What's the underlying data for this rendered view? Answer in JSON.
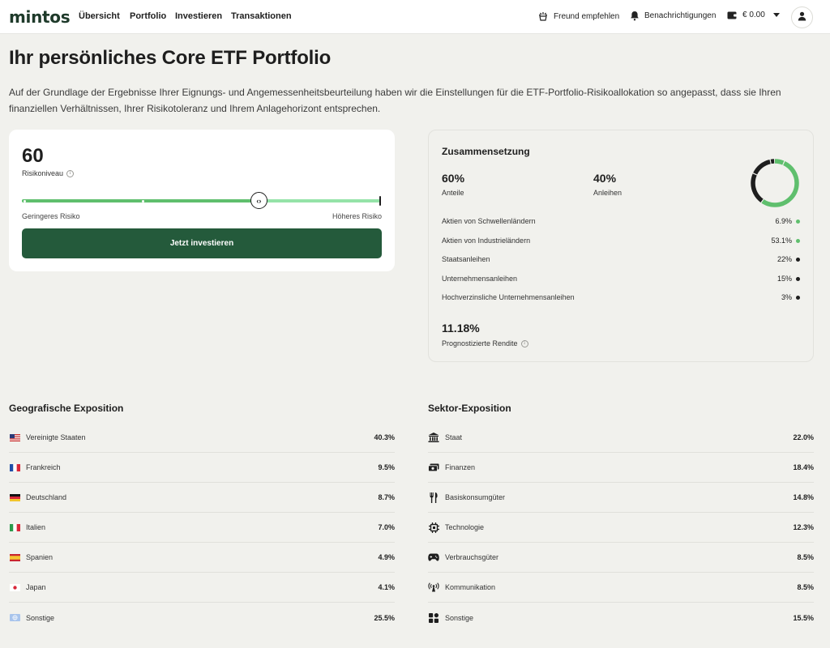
{
  "nav": {
    "logo": "mintos",
    "links": [
      "Übersicht",
      "Portfolio",
      "Investieren",
      "Transaktionen"
    ],
    "refer": "Freund empfehlen",
    "notifications": "Benachrichtigungen",
    "balance": "€ 0.00"
  },
  "page": {
    "title": "Ihr persönliches Core ETF Portfolio",
    "intro": "Auf der Grundlage der Ergebnisse Ihrer Eignungs- und Angemessenheitsbeurteilung haben wir die Einstellungen für die ETF-Portfolio-Risikoallokation so angepasst, dass sie Ihren finanziellen Verhältnissen, Ihrer Risikotoleranz und Ihrem Anlagehorizont entsprechen."
  },
  "risk": {
    "value": "60",
    "label": "Risikoniveau",
    "level_fraction": 0.66,
    "knob_glyph": "‹›",
    "min_label": "Geringeres Risiko",
    "max_label": "Höheres Risiko",
    "button": "Jetzt investieren"
  },
  "composition": {
    "title": "Zusammensetzung",
    "shares_value": "60%",
    "shares_label": "Anteile",
    "bonds_value": "40%",
    "bonds_label": "Anleihen",
    "rows": [
      {
        "label": "Aktien von Schwellenländern",
        "value": "6.9%",
        "color": "#5fbf6d",
        "pct": 6.9
      },
      {
        "label": "Aktien von Industrieländern",
        "value": "53.1%",
        "color": "#5fbf6d",
        "pct": 53.1
      },
      {
        "label": "Staatsanleihen",
        "value": "22%",
        "color": "#1e1e1e",
        "pct": 22
      },
      {
        "label": "Unternehmensanleihen",
        "value": "15%",
        "color": "#1e1e1e",
        "pct": 15
      },
      {
        "label": "Hochverzinsliche Unternehmensanleihen",
        "value": "3%",
        "color": "#1e1e1e",
        "pct": 3
      }
    ],
    "return_value": "11.18%",
    "return_label": "Prognostizierte Rendite"
  },
  "geo": {
    "title": "Geografische Exposition",
    "rows": [
      {
        "label": "Vereinigte Staaten",
        "value": "40.3%",
        "icon": "flag-us"
      },
      {
        "label": "Frankreich",
        "value": "9.5%",
        "icon": "flag-fr"
      },
      {
        "label": "Deutschland",
        "value": "8.7%",
        "icon": "flag-de"
      },
      {
        "label": "Italien",
        "value": "7.0%",
        "icon": "flag-it"
      },
      {
        "label": "Spanien",
        "value": "4.9%",
        "icon": "flag-es"
      },
      {
        "label": "Japan",
        "value": "4.1%",
        "icon": "flag-jp"
      },
      {
        "label": "Sonstige",
        "value": "25.5%",
        "icon": "globe-flag"
      }
    ]
  },
  "sector": {
    "title": "Sektor-Exposition",
    "rows": [
      {
        "label": "Staat",
        "value": "22.0%",
        "icon": "government-building-icon"
      },
      {
        "label": "Finanzen",
        "value": "18.4%",
        "icon": "money-icon"
      },
      {
        "label": "Basiskonsumgüter",
        "value": "14.8%",
        "icon": "cutlery-icon"
      },
      {
        "label": "Technologie",
        "value": "12.3%",
        "icon": "chip-icon"
      },
      {
        "label": "Verbrauchsgüter",
        "value": "8.5%",
        "icon": "gamepad-icon"
      },
      {
        "label": "Kommunikation",
        "value": "8.5%",
        "icon": "antenna-icon"
      },
      {
        "label": "Sonstige",
        "value": "15.5%",
        "icon": "grid-icon"
      }
    ]
  }
}
